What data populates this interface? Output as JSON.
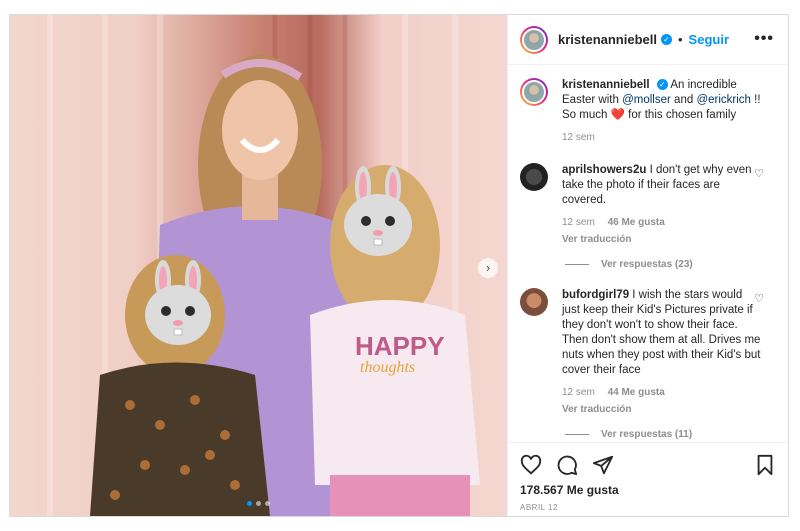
{
  "header": {
    "username": "kristenanniebell",
    "follow_label": "Seguir",
    "more_icon": "more-horizontal-icon"
  },
  "caption": {
    "username": "kristenanniebell",
    "text_1": "An incredible Easter with",
    "mention_1": "@mollser",
    "and": "and",
    "mention_2": "@erickrich",
    "text_2": "!! So much",
    "text_3": "for this chosen family",
    "time": "12 sem"
  },
  "comments": [
    {
      "username": "aprilshowers2u",
      "text": "I don't get why even take the photo if their faces are covered.",
      "time": "12 sem",
      "likes": "46 Me gusta",
      "translate": "Ver traducción",
      "replies": "Ver respuestas (23)"
    },
    {
      "username": "bufordgirl79",
      "text": "I wish the stars would just keep their Kid's Pictures private if they don't won't to show their face. Then don't show them at all. Drives me nuts when they post with their Kid's but cover their face",
      "time": "12 sem",
      "likes": "44 Me gusta",
      "translate": "Ver traducción",
      "replies": "Ver respuestas (11)"
    }
  ],
  "footer": {
    "likes": "178.567 Me gusta",
    "date": "ABRIL 12"
  },
  "photo": {
    "shirt_text_1": "HAPPY",
    "shirt_text_2": "thoughts"
  },
  "carousel": {
    "count": 3,
    "active": 1
  }
}
